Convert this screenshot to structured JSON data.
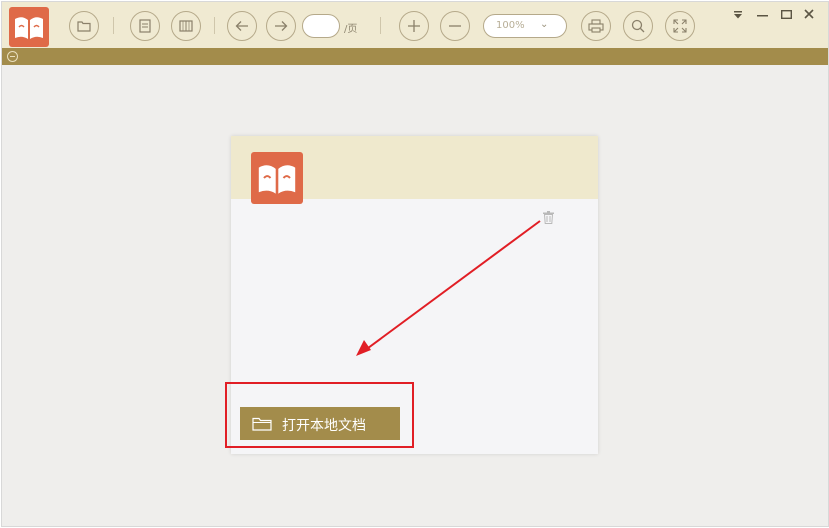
{
  "toolbar": {
    "page_separator": "/页",
    "zoom_value": "100%",
    "icons": [
      "app-logo",
      "open-folder-icon",
      "single-page-icon",
      "two-page-icon",
      "prev-page-icon",
      "next-page-icon",
      "zoom-in-icon",
      "zoom-out-icon",
      "print-icon",
      "search-icon",
      "fullscreen-icon"
    ],
    "window_controls": [
      "menu-down",
      "minimize",
      "maximize",
      "close"
    ]
  },
  "main": {
    "open_button_label": "打开本地文档",
    "delete_icon": "trash-icon"
  },
  "colors": {
    "toolbar_bg": "#f0ead2",
    "accent": "#a38c4b",
    "logo": "#df6a48",
    "highlight": "#e11e25"
  }
}
